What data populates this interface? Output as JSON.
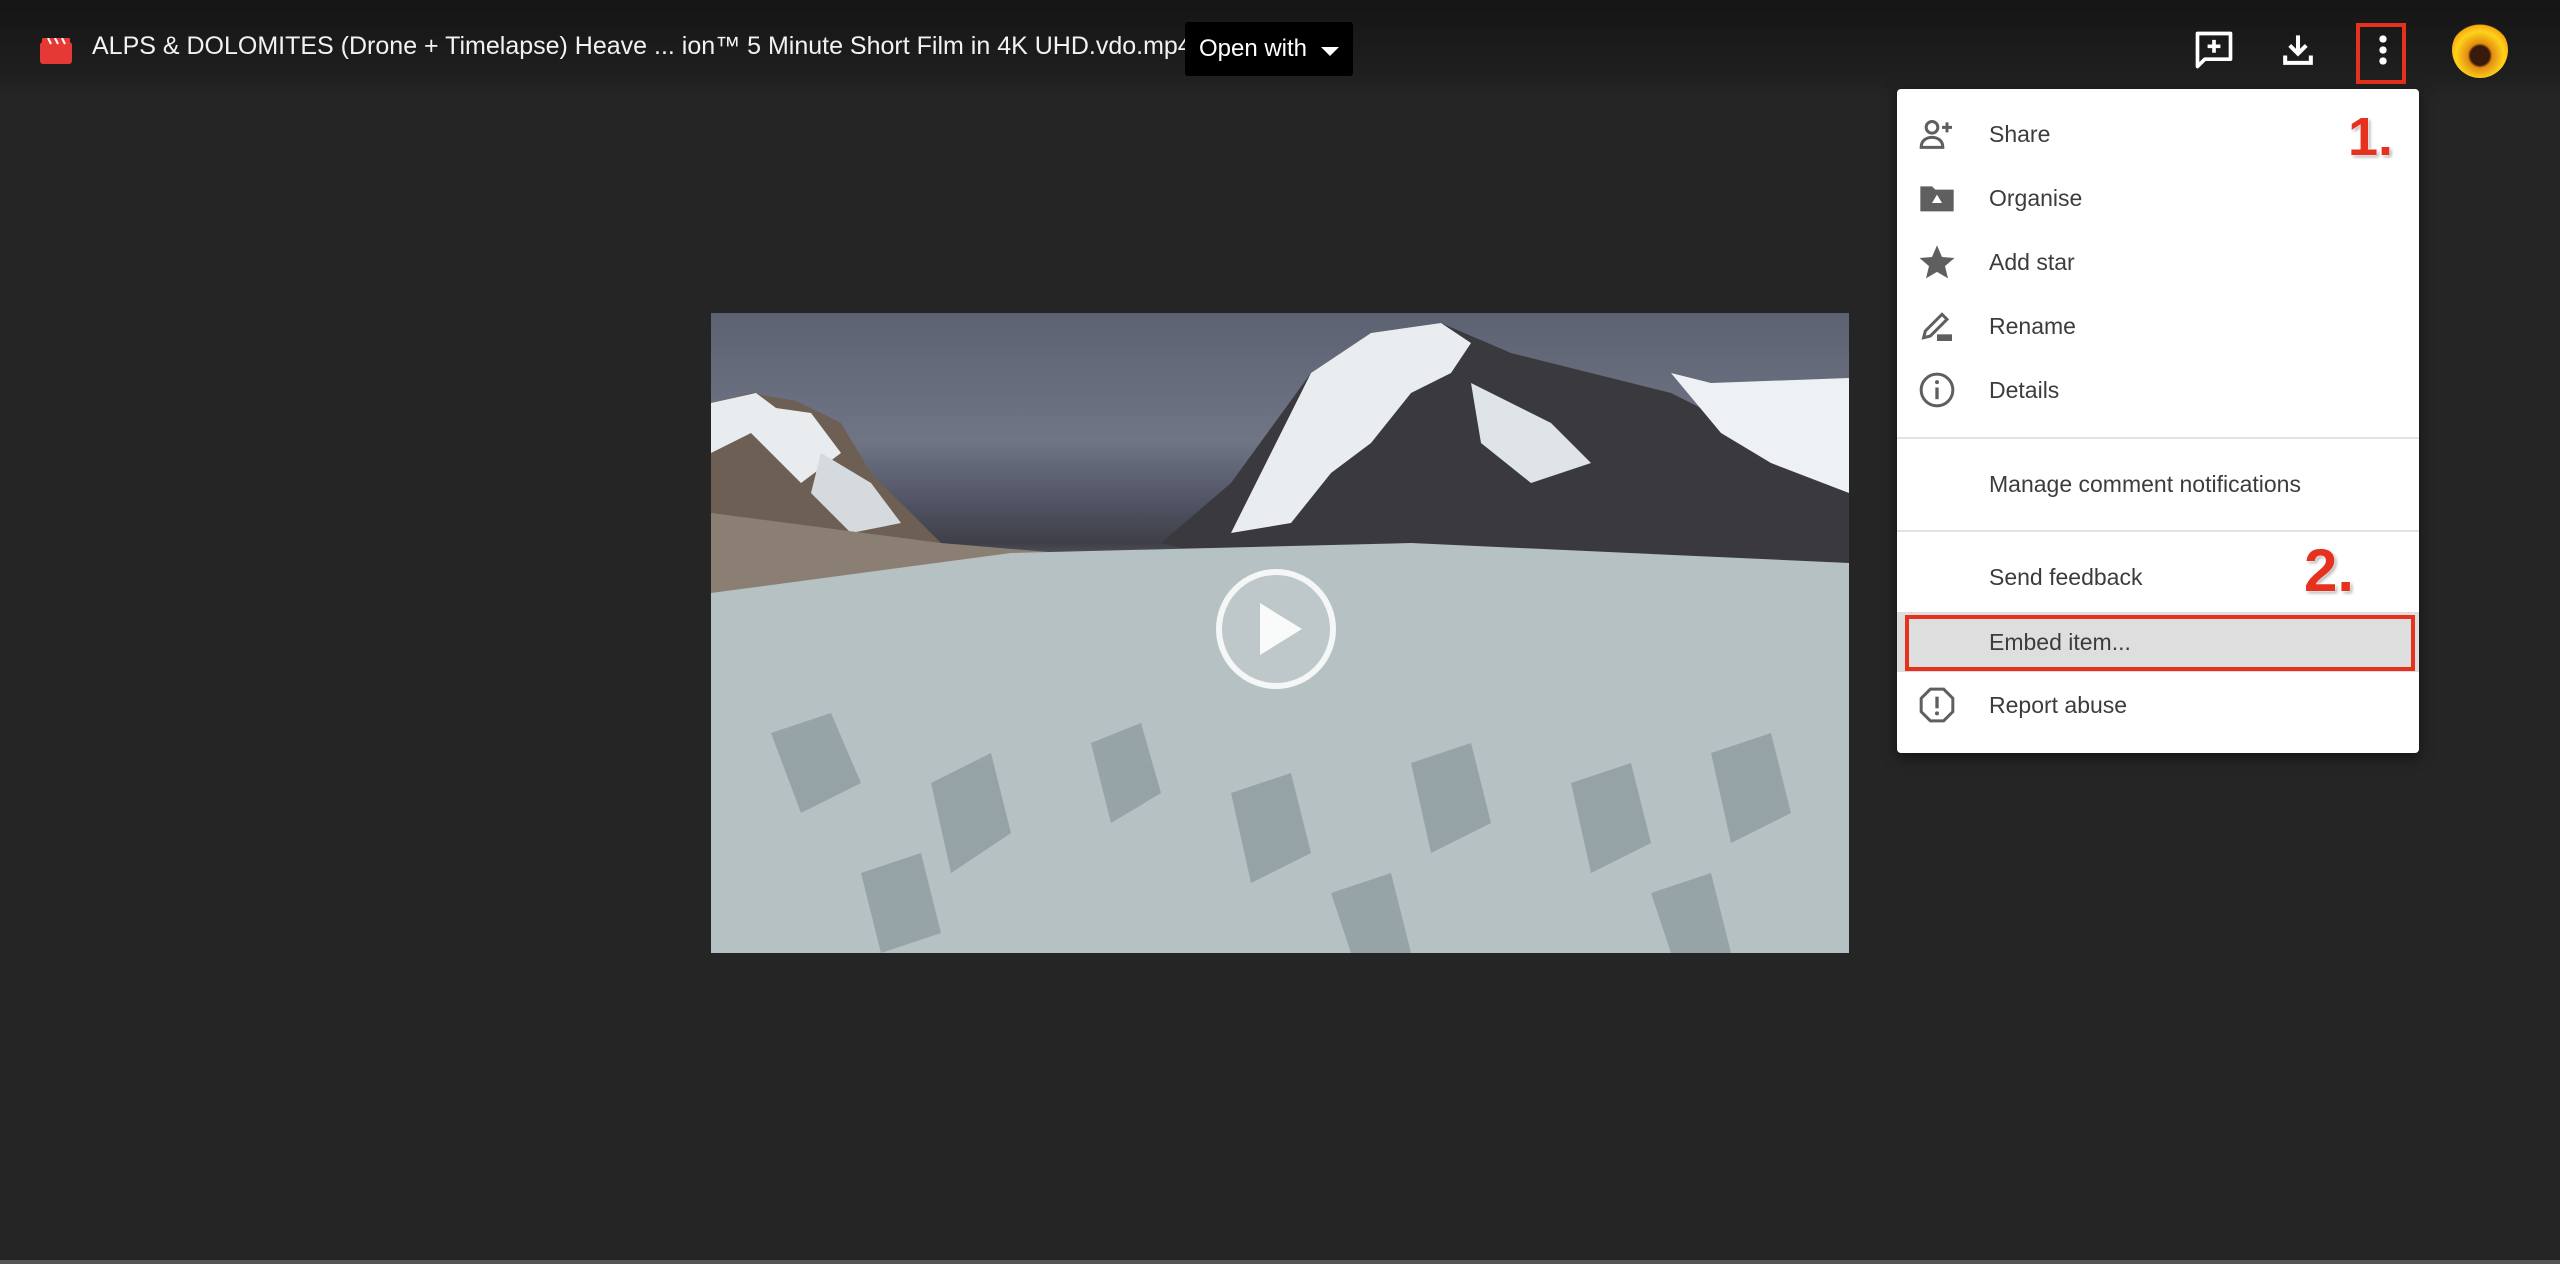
{
  "header": {
    "file_icon": "video-file-icon",
    "file_title": "ALPS & DOLOMITES (Drone + Timelapse) Heave ... ion™ 5 Minute Short Film in 4K UHD.vdo.mp4",
    "open_with_label": "Open with",
    "icons": [
      "add-comment-icon",
      "download-icon",
      "more-vert-icon"
    ],
    "avatar": "user-avatar"
  },
  "video": {
    "description": "Glacier with snow-capped mountains",
    "play_icon": "play-icon"
  },
  "menu": {
    "items": [
      {
        "label": "Share",
        "icon": "person-add-icon"
      },
      {
        "label": "Organise",
        "icon": "drive-folder-icon"
      },
      {
        "label": "Add star",
        "icon": "star-icon"
      },
      {
        "label": "Rename",
        "icon": "pencil-icon"
      },
      {
        "label": "Details",
        "icon": "info-icon"
      },
      {
        "label": "Manage comment notifications",
        "icon": ""
      },
      {
        "label": "Send feedback",
        "icon": ""
      },
      {
        "label": "Embed item...",
        "icon": "",
        "highlighted": true
      },
      {
        "label": "Report abuse",
        "icon": "report-icon"
      }
    ]
  },
  "annotations": {
    "step1": "1.",
    "step2": "2.",
    "color": "#e5311d"
  }
}
